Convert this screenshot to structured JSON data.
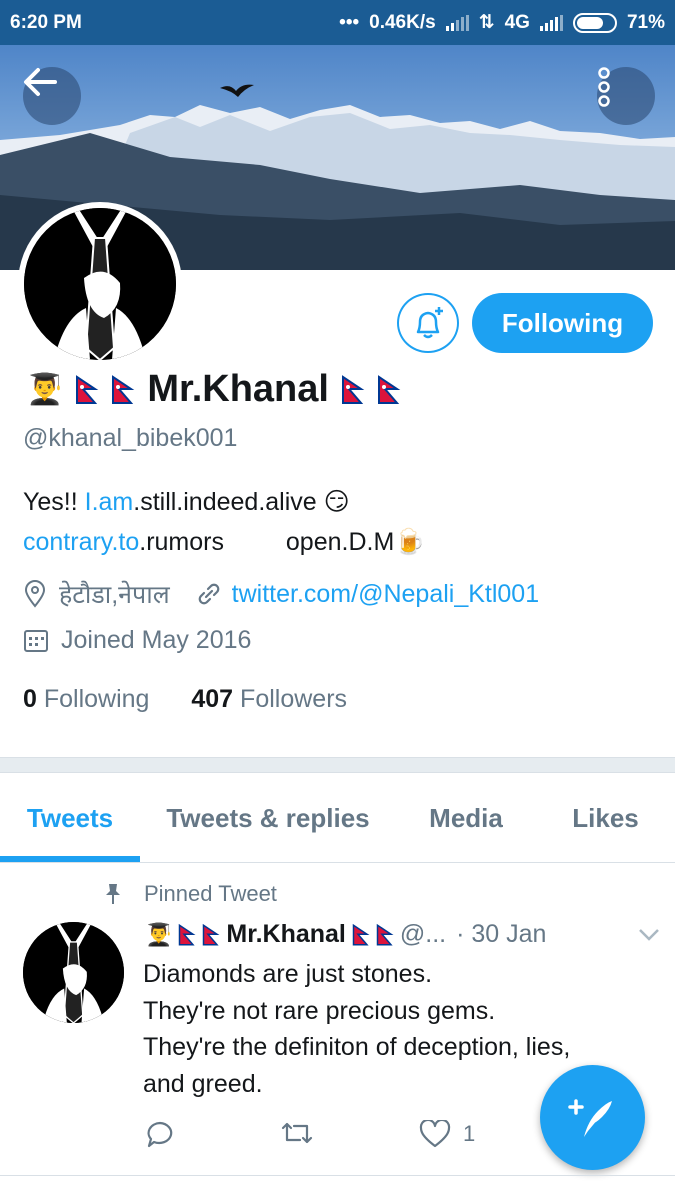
{
  "status_bar": {
    "time": "6:20 PM",
    "more": "•••",
    "speed": "0.46K/s",
    "network": "4G",
    "battery": "71%",
    "battery_level": 0.71
  },
  "header": {
    "back_icon": "arrow-left-icon",
    "more_icon": "vertical-dots-icon"
  },
  "profile": {
    "name": "Mr.Khanal",
    "handle": "@khanal_bibek001",
    "bio_line1_a": "Yes!! ",
    "bio_line1_link": "I.am",
    "bio_line1_b": ".still.indeed.alive",
    "bio_line2_link": "contrary.to",
    "bio_line2_b": ".rumors",
    "bio_line2_c": "open.D.M",
    "location": "हेटौडा,नेपाल",
    "website": "twitter.com/@Nepali_Ktl001",
    "joined": "Joined May 2016",
    "following_count": "0",
    "following_label": "Following",
    "followers_count": "407",
    "followers_label": "Followers",
    "follow_button": "Following"
  },
  "tabs": [
    {
      "label": "Tweets",
      "active": true
    },
    {
      "label": "Tweets & replies",
      "active": false
    },
    {
      "label": "Media",
      "active": false
    },
    {
      "label": "Likes",
      "active": false
    }
  ],
  "tweet": {
    "pinned_label": "Pinned Tweet",
    "name": "Mr.Khanal",
    "handle": "@...",
    "date": "· 30 Jan",
    "lines": [
      "Diamonds are just stones.",
      "They're not rare precious gems.",
      "They're the definiton of deception, lies,",
      "and greed."
    ],
    "like_count": "1"
  },
  "colors": {
    "accent": "#1da1f2",
    "status_bar": "#1b5c94",
    "muted": "#657786"
  }
}
